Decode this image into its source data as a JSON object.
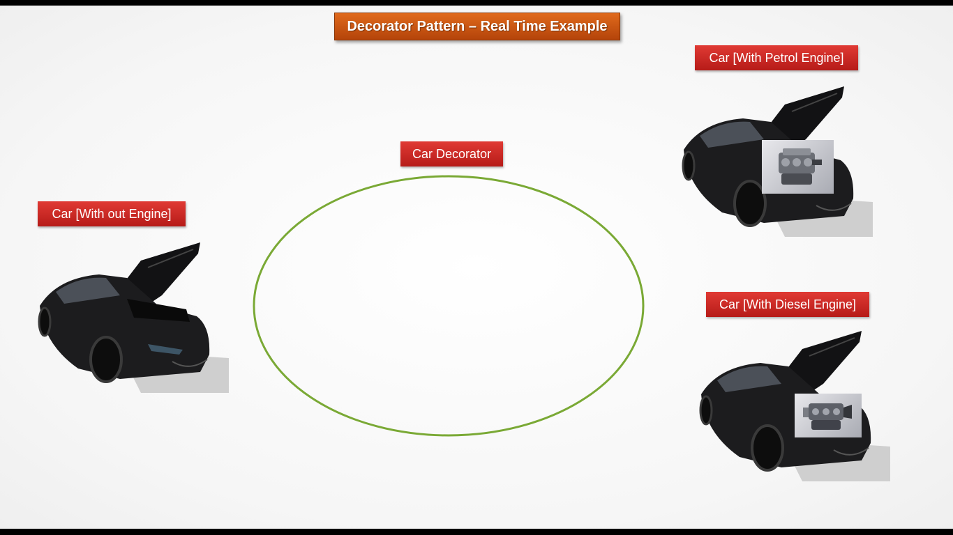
{
  "title": "Decorator Pattern – Real Time Example",
  "decorator": {
    "label": "Car Decorator",
    "stroke_color": "#7aa935"
  },
  "cars": [
    {
      "label": "Car [With out Engine]",
      "engine": "none"
    },
    {
      "label": "Car [With Petrol Engine]",
      "engine": "petrol-engine-icon"
    },
    {
      "label": "Car [With Diesel Engine]",
      "engine": "diesel-engine-icon"
    }
  ],
  "colors": {
    "title_bg": "#c9530f",
    "label_bg": "#c9221e",
    "car_body": "#1c1c1e"
  }
}
